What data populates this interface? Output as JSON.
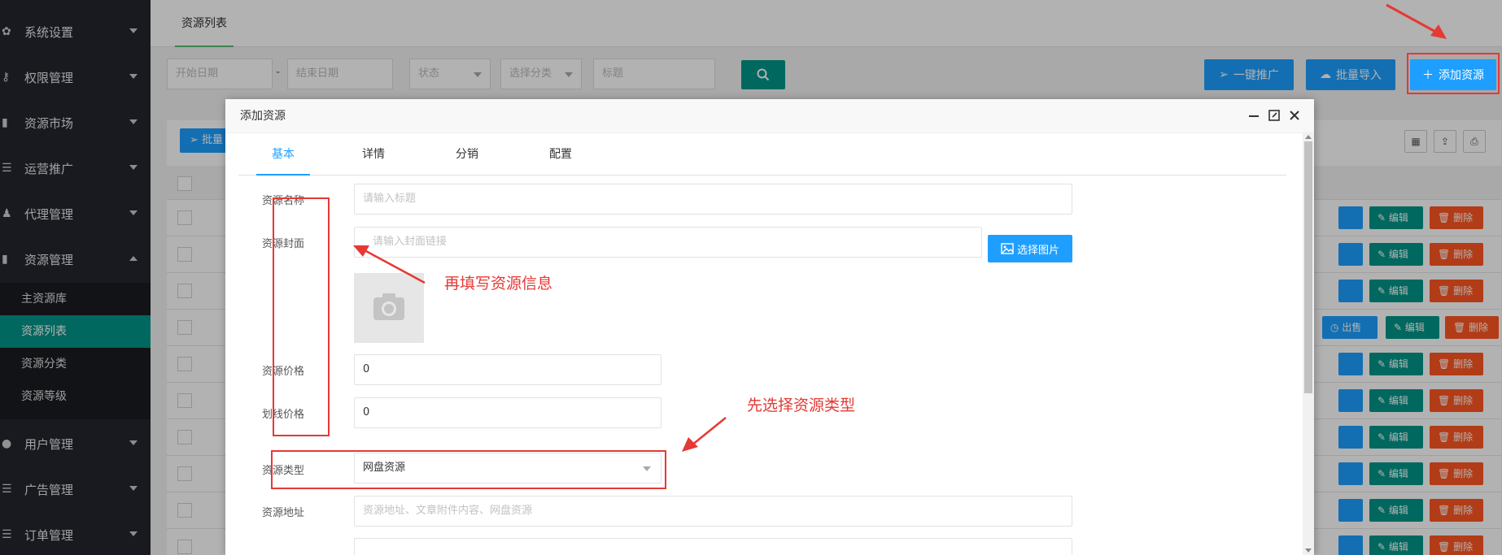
{
  "sidebar": {
    "items": [
      {
        "label": "系统设置",
        "icon": "gear-icon"
      },
      {
        "label": "权限管理",
        "icon": "users-key-icon"
      },
      {
        "label": "资源市场",
        "icon": "book-icon"
      },
      {
        "label": "运营推广",
        "icon": "list-icon"
      },
      {
        "label": "代理管理",
        "icon": "agent-icon"
      },
      {
        "label": "资源管理",
        "icon": "book-icon"
      },
      {
        "label": "用户管理",
        "icon": "user-icon"
      },
      {
        "label": "广告管理",
        "icon": "list-icon"
      },
      {
        "label": "订单管理",
        "icon": "list-icon"
      }
    ],
    "subitems": [
      {
        "label": "主资源库"
      },
      {
        "label": "资源列表"
      },
      {
        "label": "资源分类"
      },
      {
        "label": "资源等级"
      }
    ]
  },
  "tabbar": {
    "current": "资源列表"
  },
  "filters": {
    "start_date": "开始日期",
    "end_date": "结束日期",
    "status": "状态",
    "category": "选择分类",
    "title": "标题",
    "dash": "-"
  },
  "toolbar": {
    "promote": "一键推广",
    "import": "批量导入",
    "add": "添加资源"
  },
  "table": {
    "batch_label": "批量",
    "edit": "编辑",
    "delete": "删除",
    "sell": "出售"
  },
  "modal": {
    "title": "添加资源",
    "tabs": [
      "基本",
      "详情",
      "分销",
      "配置"
    ],
    "fields": {
      "name_label": "资源名称",
      "name_placeholder": "请输入标题",
      "cover_label": "资源封面",
      "cover_placeholder": "请输入封面链接",
      "pick_image": "选择图片",
      "price_label": "资源价格",
      "price_value": "0",
      "strike_label": "划线价格",
      "strike_value": "0",
      "type_label": "资源类型",
      "type_value": "网盘资源",
      "addr_label": "资源地址",
      "addr_placeholder": "资源地址、文章附件内容、网盘资源"
    }
  },
  "annotations": {
    "fill_info": "再填写资源信息",
    "choose_type": "先选择资源类型"
  },
  "colors": {
    "sidebar_bg": "#23262e",
    "active_green": "#009688",
    "primary_blue": "#1e9fff",
    "danger": "#ff5722",
    "annotation_red": "#e53935"
  }
}
